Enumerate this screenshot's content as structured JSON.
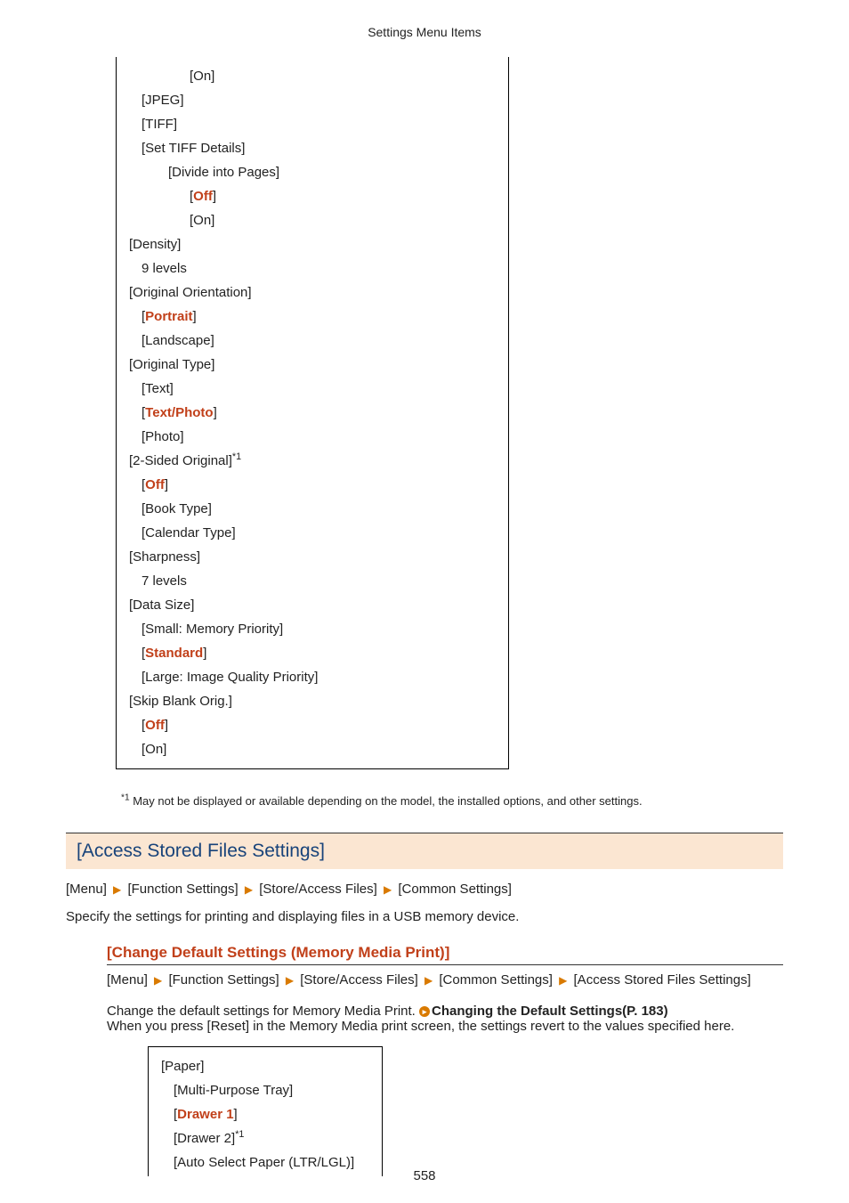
{
  "header": {
    "title": "Settings Menu Items"
  },
  "box1": {
    "lines": [
      {
        "text": "[On]",
        "indent": "ind4",
        "hl": false
      },
      {
        "text": "[JPEG]",
        "indent": "ind1",
        "hl": false
      },
      {
        "text": "[TIFF]",
        "indent": "ind1",
        "hl": false
      },
      {
        "text": "[Set TIFF Details]",
        "indent": "ind1",
        "hl": false
      },
      {
        "text": "[Divide into Pages]",
        "indent": "ind2",
        "hl": false
      },
      {
        "seg": [
          {
            "t": "[",
            "hl": false
          },
          {
            "t": "Off",
            "hl": true
          },
          {
            "t": "]",
            "hl": false
          }
        ],
        "indent": "ind3"
      },
      {
        "text": "[On]",
        "indent": "ind3",
        "hl": false
      },
      {
        "text": "[Density]",
        "indent": "ind0",
        "hl": false
      },
      {
        "text": "9 levels",
        "indent": "ind1",
        "hl": false
      },
      {
        "text": "[Original Orientation]",
        "indent": "ind0",
        "hl": false
      },
      {
        "seg": [
          {
            "t": "[",
            "hl": false
          },
          {
            "t": "Portrait",
            "hl": true
          },
          {
            "t": "]",
            "hl": false
          }
        ],
        "indent": "ind1"
      },
      {
        "text": "[Landscape]",
        "indent": "ind1",
        "hl": false
      },
      {
        "text": "[Original Type]",
        "indent": "ind0",
        "hl": false
      },
      {
        "text": "[Text]",
        "indent": "ind1",
        "hl": false
      },
      {
        "seg": [
          {
            "t": "[",
            "hl": false
          },
          {
            "t": "Text/Photo",
            "hl": true
          },
          {
            "t": "]",
            "hl": false
          }
        ],
        "indent": "ind1"
      },
      {
        "text": "[Photo]",
        "indent": "ind1",
        "hl": false
      },
      {
        "seg": [
          {
            "t": "[2-Sided Original]",
            "hl": false
          },
          {
            "t": "",
            "sup": "*1"
          }
        ],
        "indent": "ind0"
      },
      {
        "seg": [
          {
            "t": "[",
            "hl": false
          },
          {
            "t": "Off",
            "hl": true
          },
          {
            "t": "]",
            "hl": false
          }
        ],
        "indent": "ind1"
      },
      {
        "text": "[Book Type]",
        "indent": "ind1",
        "hl": false
      },
      {
        "text": "[Calendar Type]",
        "indent": "ind1",
        "hl": false
      },
      {
        "text": "[Sharpness]",
        "indent": "ind0",
        "hl": false
      },
      {
        "text": "7 levels",
        "indent": "ind1",
        "hl": false
      },
      {
        "text": "[Data Size]",
        "indent": "ind0",
        "hl": false
      },
      {
        "text": "[Small: Memory Priority]",
        "indent": "ind1",
        "hl": false
      },
      {
        "seg": [
          {
            "t": "[",
            "hl": false
          },
          {
            "t": "Standard",
            "hl": true
          },
          {
            "t": "]",
            "hl": false
          }
        ],
        "indent": "ind1"
      },
      {
        "text": "[Large: Image Quality Priority]",
        "indent": "ind1",
        "hl": false
      },
      {
        "text": "[Skip Blank Orig.]",
        "indent": "ind0",
        "hl": false
      },
      {
        "seg": [
          {
            "t": "[",
            "hl": false
          },
          {
            "t": "Off",
            "hl": true
          },
          {
            "t": "]",
            "hl": false
          }
        ],
        "indent": "ind1"
      },
      {
        "text": "[On]",
        "indent": "ind1",
        "hl": false
      }
    ]
  },
  "footnote": {
    "marker": "*1",
    "text": " May not be displayed or available depending on the model, the installed options, and other settings."
  },
  "section": {
    "title": "[Access Stored Files Settings]"
  },
  "breadcrumb1": {
    "parts": [
      "[Menu]",
      "[Function Settings]",
      "[Store/Access Files]",
      "[Common Settings]"
    ]
  },
  "desc1": "Specify the settings for printing and displaying files in a USB memory device.",
  "sub": {
    "title": "[Change Default Settings (Memory Media Print)]",
    "breadcrumb": {
      "parts": [
        "[Menu]",
        "[Function Settings]",
        "[Store/Access Files]",
        "[Common Settings]",
        "[Access Stored Files Settings]"
      ]
    },
    "para_pre": "Change the default settings for Memory Media Print. ",
    "para_link": "Changing the Default Settings(P. 183)",
    "para_post": "When you press [Reset] in the Memory Media print screen, the settings revert to the values specified here."
  },
  "box2": {
    "lines": [
      {
        "text": "[Paper]",
        "indent": "ind0",
        "hl": false
      },
      {
        "text": "[Multi-Purpose Tray]",
        "indent": "ind1",
        "hl": false
      },
      {
        "seg": [
          {
            "t": "[",
            "hl": false
          },
          {
            "t": "Drawer 1",
            "hl": true
          },
          {
            "t": "]",
            "hl": false
          }
        ],
        "indent": "ind1"
      },
      {
        "seg": [
          {
            "t": "[Drawer 2]",
            "hl": false
          },
          {
            "t": "",
            "sup": "*1"
          }
        ],
        "indent": "ind1"
      },
      {
        "text": "[Auto Select Paper (LTR/LGL)]",
        "indent": "ind1",
        "hl": false
      }
    ]
  },
  "pagenum": "558"
}
